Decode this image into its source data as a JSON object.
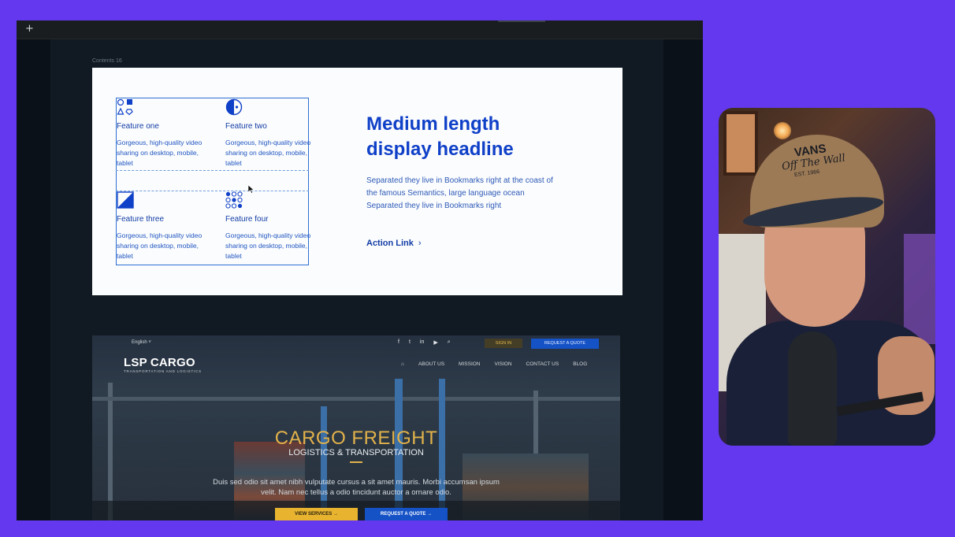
{
  "editor": {
    "add_label": "+",
    "frame_label": "Contents 16"
  },
  "component": {
    "features": [
      {
        "title": "Feature one",
        "description": "Gorgeous, high-quality video sharing on desktop, mobile, tablet",
        "icon": "shapes-icon"
      },
      {
        "title": "Feature two",
        "description": "Gorgeous, high-quality video sharing on desktop, mobile, tablet",
        "icon": "half-circle-icon"
      },
      {
        "title": "Feature three",
        "description": "Gorgeous, high-quality video sharing on desktop, mobile, tablet",
        "icon": "triangle-square-icon"
      },
      {
        "title": "Feature four",
        "description": "Gorgeous, high-quality video sharing on desktop, mobile, tablet",
        "icon": "dot-grid-icon"
      }
    ],
    "headline": "Medium length display headline",
    "body": "Separated they live in Bookmarks right at the coast of the famous Semantics, large language ocean Separated they live in Bookmarks right",
    "action_link": "Action Link",
    "action_chevron": "›"
  },
  "site": {
    "language": "English ˅",
    "social": [
      "f",
      "t",
      "in",
      "▶",
      "⌕"
    ],
    "signin": "SIGN IN",
    "request_quote_top": "REQUEST A QUOTE",
    "logo": "LSP CARGO",
    "logo_sub": "TRANSPORTATION AND LOGISTICS",
    "nav": [
      "ABOUT US",
      "MISSION",
      "VISION",
      "CONTACT US",
      "BLOG"
    ],
    "hero_title": "CARGO FREIGHT",
    "hero_subtitle": "LOGISTICS & TRANSPORTATION",
    "hero_text": "Duis sed odio sit amet nibh vulputate cursus a sit amet mauris. Morbi accumsan ipsum velit. Nam nec tellus a odio tincidunt auctor a ornare odio.",
    "btn_services": "VIEW SERVICES  →",
    "btn_quote": "REQUEST A QUOTE  →"
  },
  "webcam": {
    "cap_brand": "VANS",
    "cap_script": "Off The Wall",
    "cap_est": "EST. 1966"
  },
  "colors": {
    "background": "#6338ee",
    "accent_blue": "#0f40c8",
    "site_gold": "#e2b24a"
  }
}
